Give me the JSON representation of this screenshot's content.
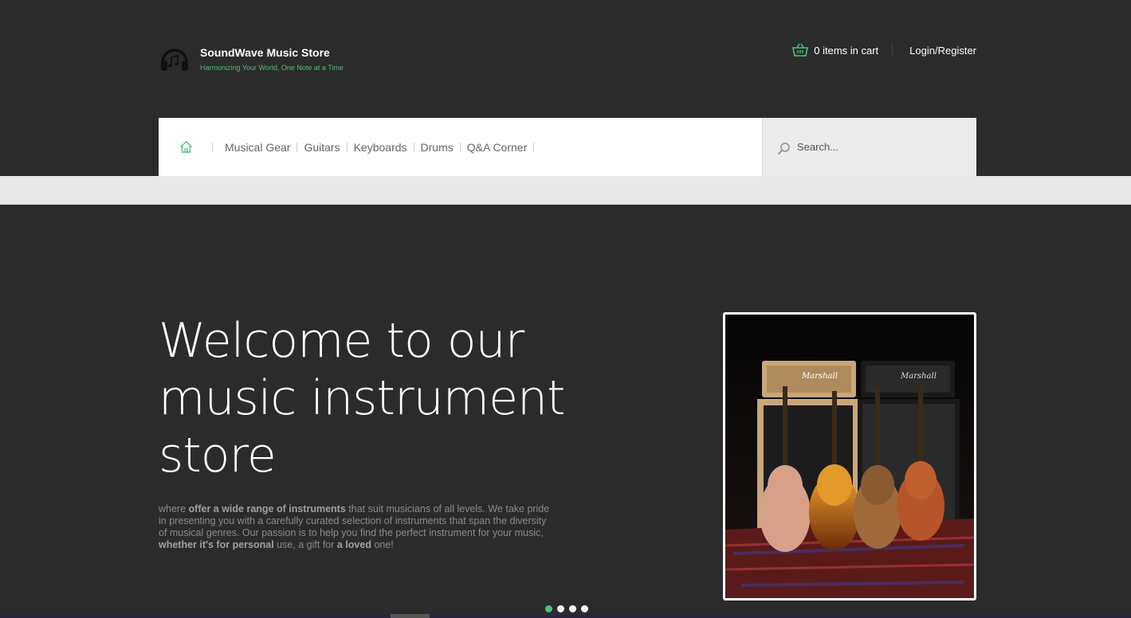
{
  "brand": {
    "title": "SoundWave Music Store",
    "tagline": "Harmonizing Your World, One Note at a Time",
    "logo_icon": "headphones-icon"
  },
  "topbar": {
    "cart_label": "0 items in cart",
    "cart_icon": "basket-icon",
    "login_label": "Login/Register"
  },
  "nav": {
    "home_icon": "home-icon",
    "items": [
      {
        "label": "Musical Gear"
      },
      {
        "label": "Guitars"
      },
      {
        "label": "Keyboards"
      },
      {
        "label": "Drums"
      },
      {
        "label": "Q&A Corner"
      }
    ]
  },
  "search": {
    "placeholder": "Search...",
    "icon": "search-icon"
  },
  "hero": {
    "title": "Welcome to our music instrument store",
    "body_parts": [
      {
        "text": "where ",
        "bold": false
      },
      {
        "text": "offer a wide range of instruments",
        "bold": true
      },
      {
        "text": " that suit musicians of all levels. We take pride in presenting you with a carefully curated selection of instruments that span the diversity of musical genres. Our passion is to help you find the perfect instrument for your music, ",
        "bold": false
      },
      {
        "text": "whether it's for personal",
        "bold": true
      },
      {
        "text": " use, a gift for ",
        "bold": false
      },
      {
        "text": "a loved",
        "bold": true
      },
      {
        "text": " one!",
        "bold": false
      }
    ],
    "image": {
      "amp_brand_left": "Marshall",
      "amp_brand_right": "Marshall"
    }
  },
  "slider": {
    "dot_count": 4,
    "active_index": 0
  },
  "colors": {
    "background": "#2b2b2b",
    "accent": "#4fbf7c",
    "nav_bg": "#ffffff",
    "search_bg": "#ebebeb"
  }
}
